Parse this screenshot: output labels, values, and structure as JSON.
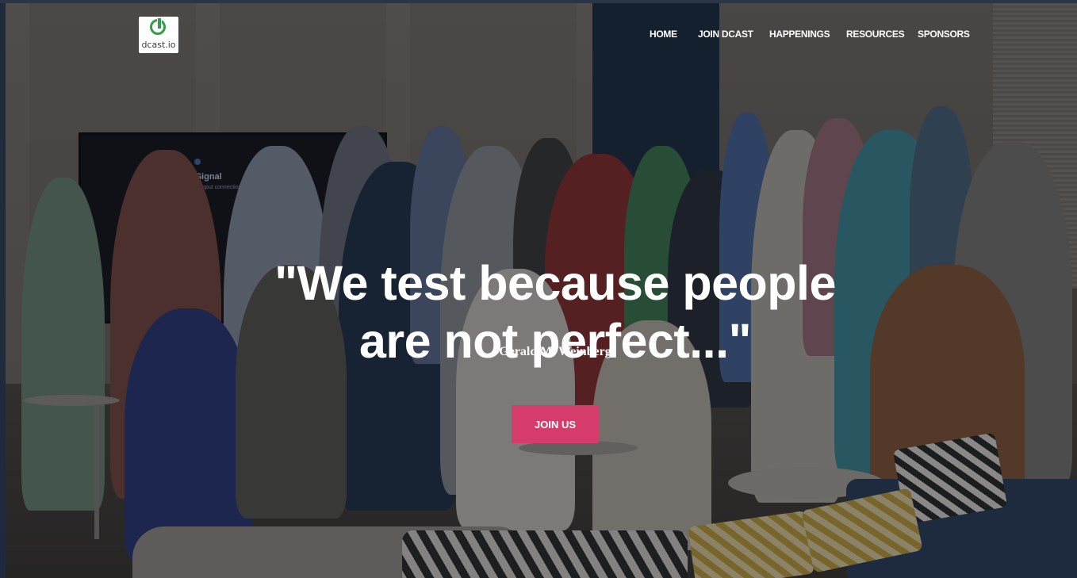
{
  "header": {
    "logo_text": "dcast.io",
    "nav": [
      {
        "label": "HOME"
      },
      {
        "label": "JOIN DCAST"
      },
      {
        "label": "HAPPENINGS"
      },
      {
        "label": "RESOURCES"
      },
      {
        "label": "SPONSORS"
      }
    ]
  },
  "background": {
    "tv_title": "No Signal",
    "tv_subtitle": "eck the input connection"
  },
  "hero": {
    "quote_line1": "\"We test because people",
    "quote_line2": "are not perfect...\"",
    "author": "Gerald M. Weinberg",
    "cta_label": "JOIN US"
  },
  "colors": {
    "cta": "#d53c6b",
    "logo_green": "#2f9e45"
  }
}
